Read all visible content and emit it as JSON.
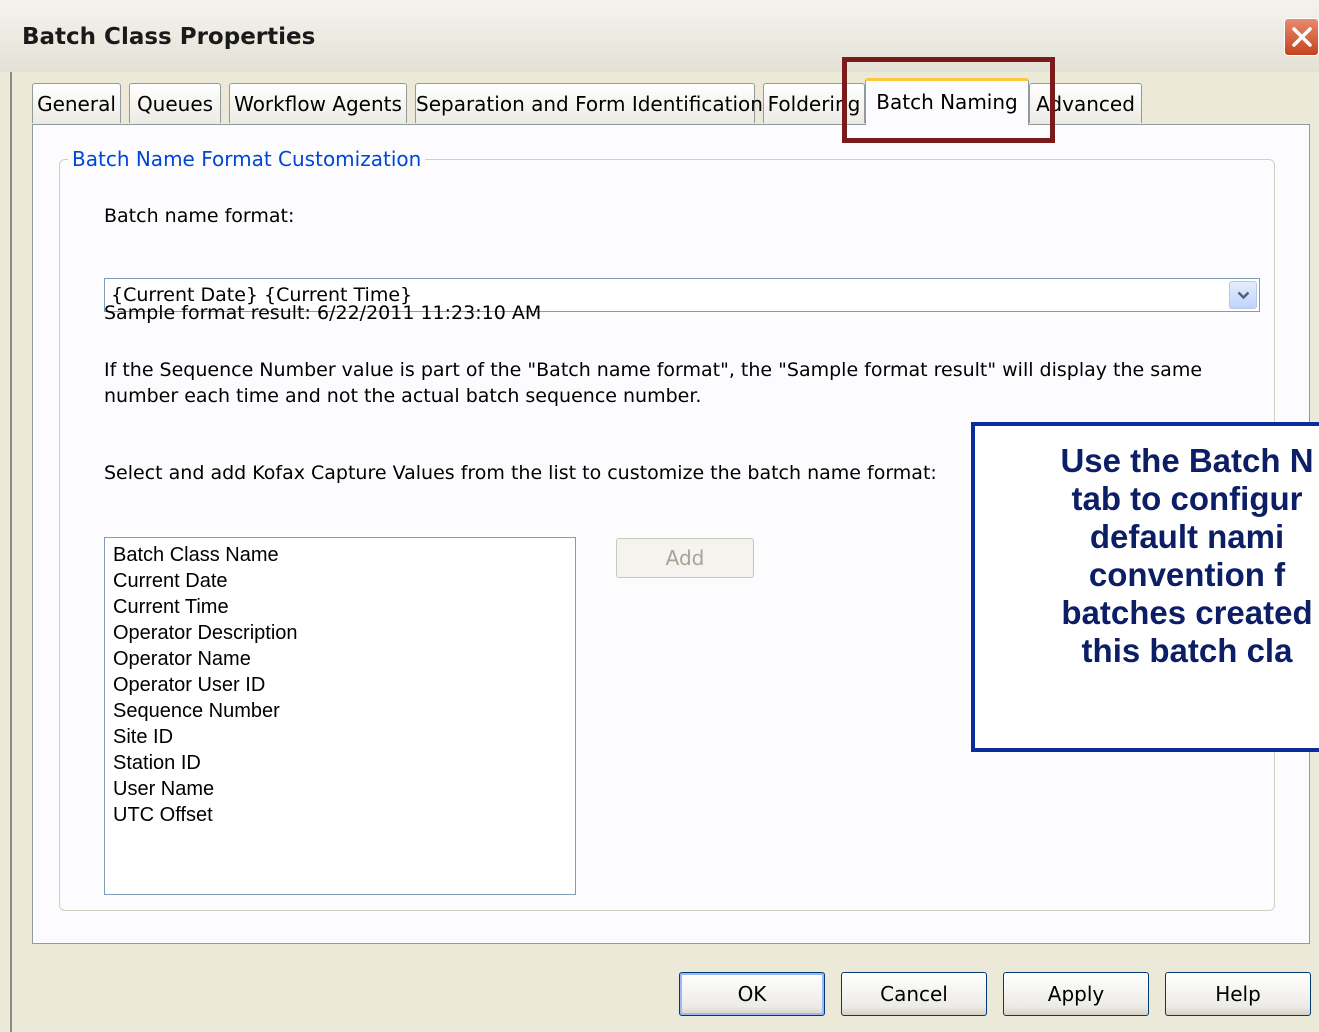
{
  "window": {
    "title": "Batch Class Properties",
    "close_icon": "close-icon"
  },
  "tabs": [
    {
      "label": "General",
      "active": false
    },
    {
      "label": "Queues",
      "active": false
    },
    {
      "label": "Workflow Agents",
      "active": false
    },
    {
      "label": "Separation and Form Identification",
      "active": false
    },
    {
      "label": "Foldering",
      "active": false
    },
    {
      "label": "Batch Naming",
      "active": true
    },
    {
      "label": "Advanced",
      "active": false
    }
  ],
  "group": {
    "title": "Batch Name Format Customization",
    "format_label": "Batch name format:",
    "format_value": "{Current Date} {Current Time}",
    "sample_label": "Sample format result:",
    "sample_value": "6/22/2011 11:23:10 AM",
    "note_line1": "If the Sequence Number value is part of the \"Batch name format\", the \"Sample format result\" will display the same",
    "note_line2": "number each time and not the actual batch sequence number.",
    "select_label": "Select and add Kofax Capture Values from the list to customize the batch name format:",
    "values": [
      "Batch Class Name",
      "Current Date",
      "Current Time",
      "Operator Description",
      "Operator Name",
      "Operator User ID",
      "Sequence Number",
      "Site ID",
      "Station ID",
      "User Name",
      "UTC Offset"
    ],
    "add_label": "Add"
  },
  "buttons": {
    "ok": "OK",
    "cancel": "Cancel",
    "apply": "Apply",
    "help": "Help"
  },
  "callout": {
    "text": "Use the Batch N\ntab to configur\ndefault nami\nconvention f\nbatches created\nthis batch cla"
  },
  "colors": {
    "highlight_border": "#7a1a1a",
    "callout_border": "#0b2c9a",
    "callout_text": "#0c1e66",
    "group_title": "#0046d5"
  }
}
